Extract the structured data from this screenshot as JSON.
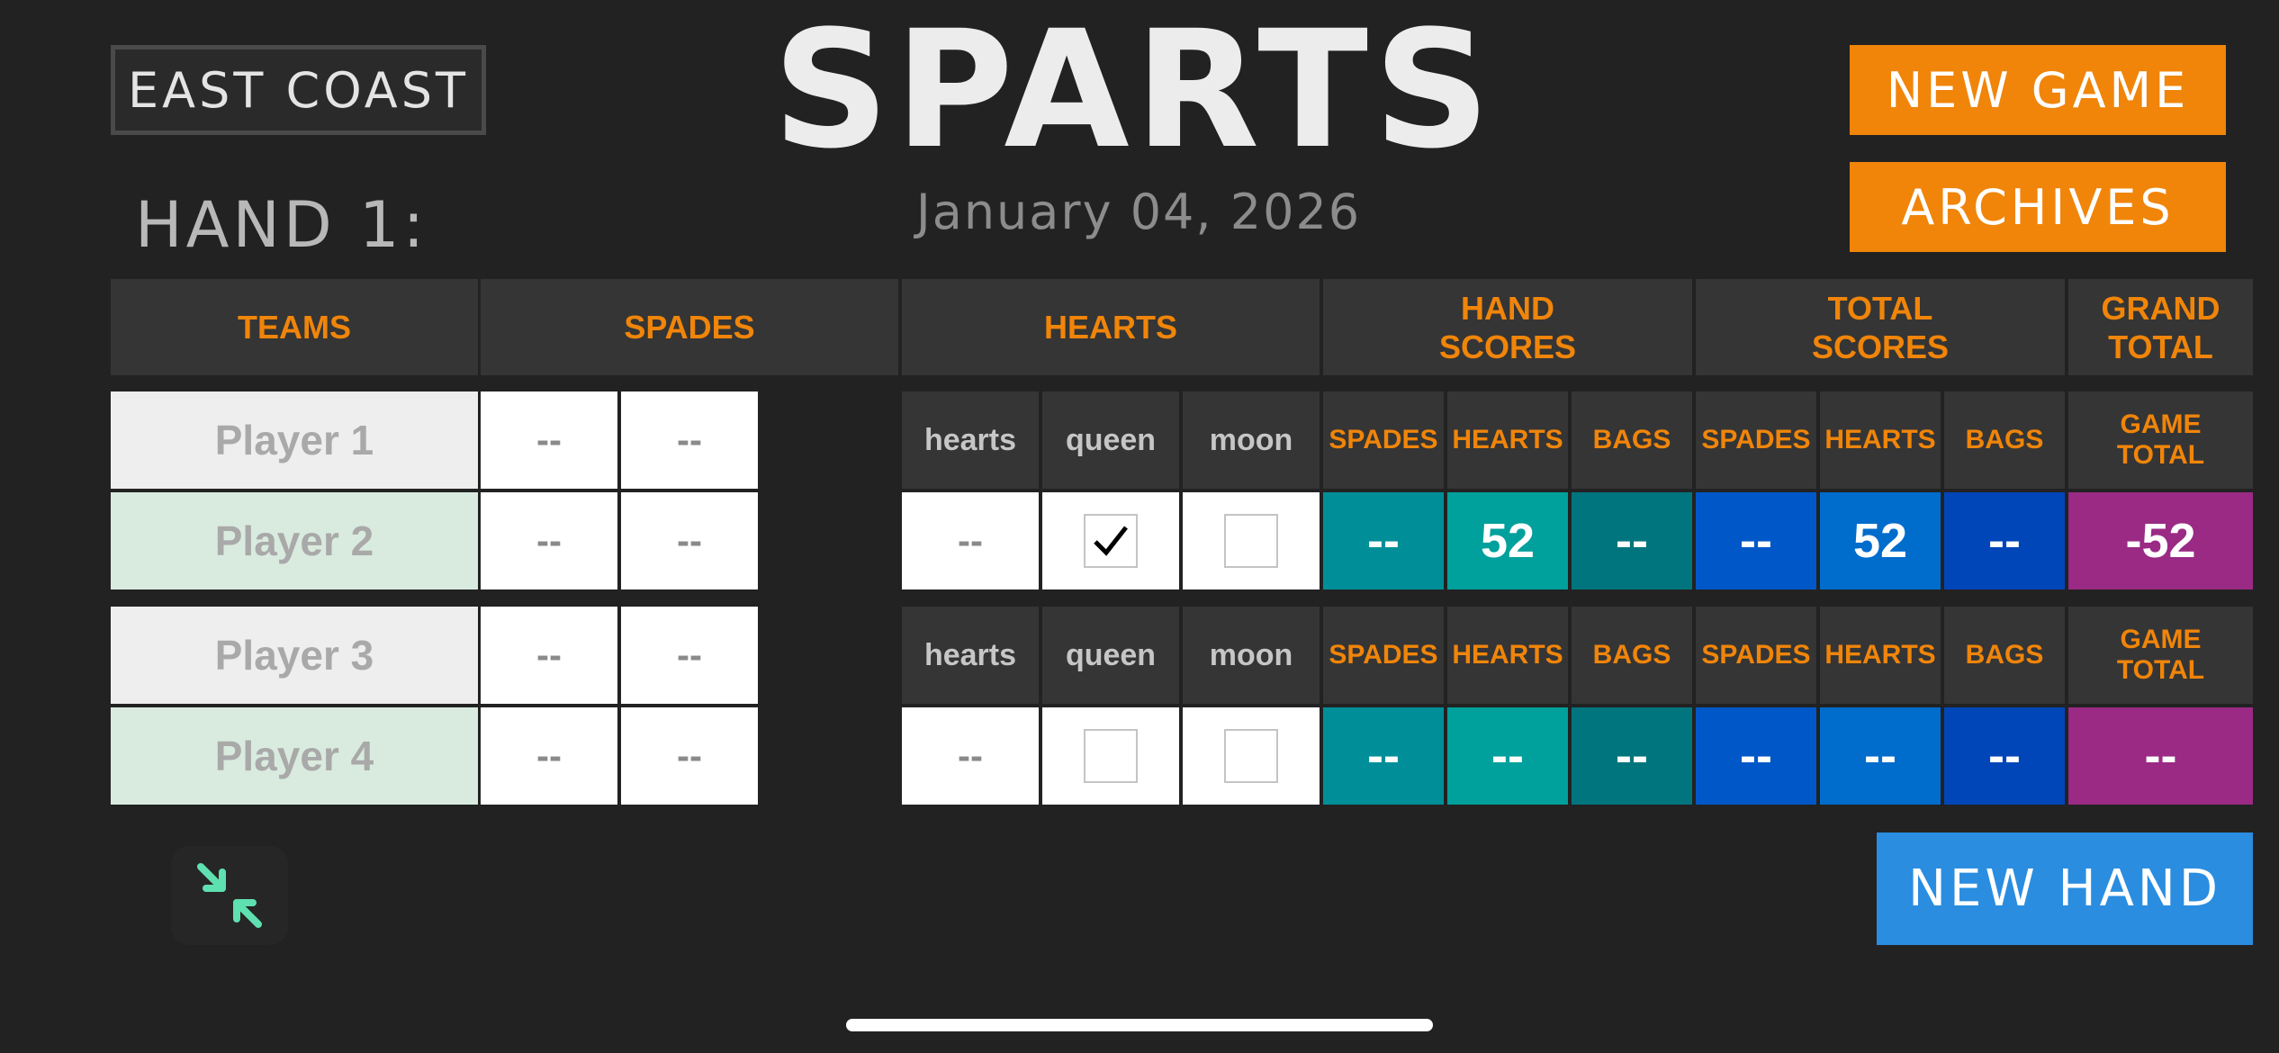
{
  "header": {
    "region": "EAST COAST",
    "app_title": "SPARTS",
    "hand_label": "HAND 1:",
    "date": "January 04, 2026",
    "new_game": "NEW GAME",
    "archives": "ARCHIVES"
  },
  "columns": {
    "teams": "TEAMS",
    "spades": "SPADES",
    "hearts": "HEARTS",
    "hand_scores": "HAND SCORES",
    "total_scores": "TOTAL SCORES",
    "grand_total": "GRAND TOTAL"
  },
  "subheaders": {
    "hearts": "hearts",
    "queen": "queen",
    "moon": "moon",
    "spades": "SPADES",
    "hearts_caps": "HEARTS",
    "bags": "BAGS",
    "game_total": "GAME TOTAL"
  },
  "teams": [
    {
      "players": [
        {
          "name": "Player 1",
          "bid": "--",
          "tricks": "--"
        },
        {
          "name": "Player 2",
          "bid": "--",
          "tricks": "--"
        }
      ],
      "hearts_taken": "--",
      "queen_checked": true,
      "moon_checked": false,
      "hand_scores": {
        "spades": "--",
        "hearts": "52",
        "bags": "--"
      },
      "total_scores": {
        "spades": "--",
        "hearts": "52",
        "bags": "--"
      },
      "game_total": "-52"
    },
    {
      "players": [
        {
          "name": "Player 3",
          "bid": "--",
          "tricks": "--"
        },
        {
          "name": "Player 4",
          "bid": "--",
          "tricks": "--"
        }
      ],
      "hearts_taken": "--",
      "queen_checked": false,
      "moon_checked": false,
      "hand_scores": {
        "spades": "--",
        "hearts": "--",
        "bags": "--"
      },
      "total_scores": {
        "spades": "--",
        "hearts": "--",
        "bags": "--"
      },
      "game_total": "--"
    }
  ],
  "footer": {
    "new_hand": "NEW HAND",
    "collapse_icon": "collapse-arrows-icon"
  },
  "colors": {
    "accent_orange": "#f0850a",
    "teal": "#008f98",
    "blue": "#0058c8",
    "purple": "#9a2a84",
    "new_hand_blue": "#2a8de0"
  }
}
